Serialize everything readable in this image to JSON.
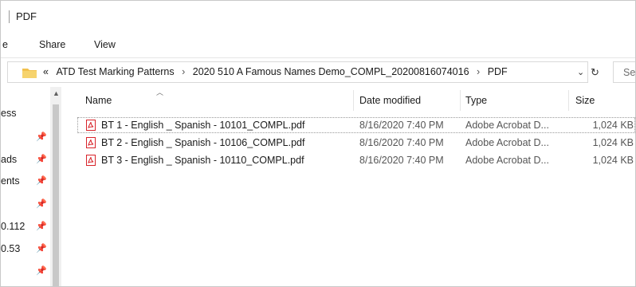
{
  "window": {
    "title": "PDF"
  },
  "ribbon": {
    "tabs": [
      "e",
      "Share",
      "View"
    ]
  },
  "address": {
    "prefix": "«",
    "crumbs": [
      "ATD Test Marking Patterns",
      "2020 510 A Famous Names Demo_COMPL_20200816074016",
      "PDF"
    ],
    "separator": "›",
    "dropdown": "⌄",
    "refresh": "↻",
    "search_placeholder": "Se"
  },
  "nav": {
    "items": [
      {
        "label": "ess",
        "pinned": false
      },
      {
        "label": "",
        "pinned": true
      },
      {
        "label": "ads",
        "pinned": true
      },
      {
        "label": "ents",
        "pinned": true
      },
      {
        "label": "",
        "pinned": true
      },
      {
        "label": "0.112",
        "pinned": true
      },
      {
        "label": "0.53",
        "pinned": true
      },
      {
        "label": "",
        "pinned": true
      }
    ]
  },
  "columns": {
    "name": "Name",
    "date": "Date modified",
    "type": "Type",
    "size": "Size"
  },
  "files": [
    {
      "name": "BT 1 - English _ Spanish - 10101_COMPL.pdf",
      "date": "8/16/2020 7:40 PM",
      "type": "Adobe Acrobat D...",
      "size": "1,024 KB",
      "selected": true
    },
    {
      "name": "BT 2 - English _ Spanish - 10106_COMPL.pdf",
      "date": "8/16/2020 7:40 PM",
      "type": "Adobe Acrobat D...",
      "size": "1,024 KB",
      "selected": false
    },
    {
      "name": "BT 3 - English _ Spanish - 10110_COMPL.pdf",
      "date": "8/16/2020 7:40 PM",
      "type": "Adobe Acrobat D...",
      "size": "1,024 KB",
      "selected": false
    }
  ],
  "colors": {
    "pdf_red": "#d8232a",
    "folder_yellow": "#f2c14e",
    "accent_blue": "#0063b1"
  }
}
